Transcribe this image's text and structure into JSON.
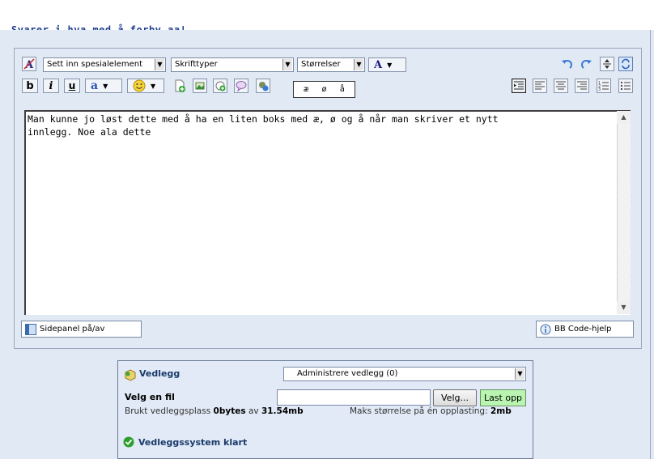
{
  "page": {
    "title": "Svarer i hva med å forby aa!"
  },
  "toolbar": {
    "special_elements": "Sett inn spesialelement",
    "fonts": "Skrifttyper",
    "sizes": "Størrelser",
    "font_color_label": "A",
    "bold": "b",
    "italic": "i",
    "underline": "u",
    "highlight": "a",
    "chars": [
      "æ",
      "ø",
      "å"
    ]
  },
  "editor": {
    "text": "Man kunne jo løst dette med å ha en liten boks med æ, ø og å når man skriver et nytt\ninnlegg. Noe ala dette"
  },
  "sidepanel": {
    "toggle_label": "Sidepanel på/av"
  },
  "help": {
    "bbcode_label": "BB Code-hjelp"
  },
  "attachments": {
    "title": "Vedlegg",
    "manage_select": "Administrere vedlegg (0)",
    "choose_file_label": "Velg en fil",
    "browse_button": "Velg...",
    "upload_button": "Last opp",
    "used_prefix": "Brukt vedleggsplass",
    "used_value": "0bytes",
    "used_of": "av",
    "used_total": "31.54mb",
    "max_label": "Maks størrelse på én opplasting:",
    "max_value": "2mb",
    "status": "Vedleggssystem klart"
  }
}
